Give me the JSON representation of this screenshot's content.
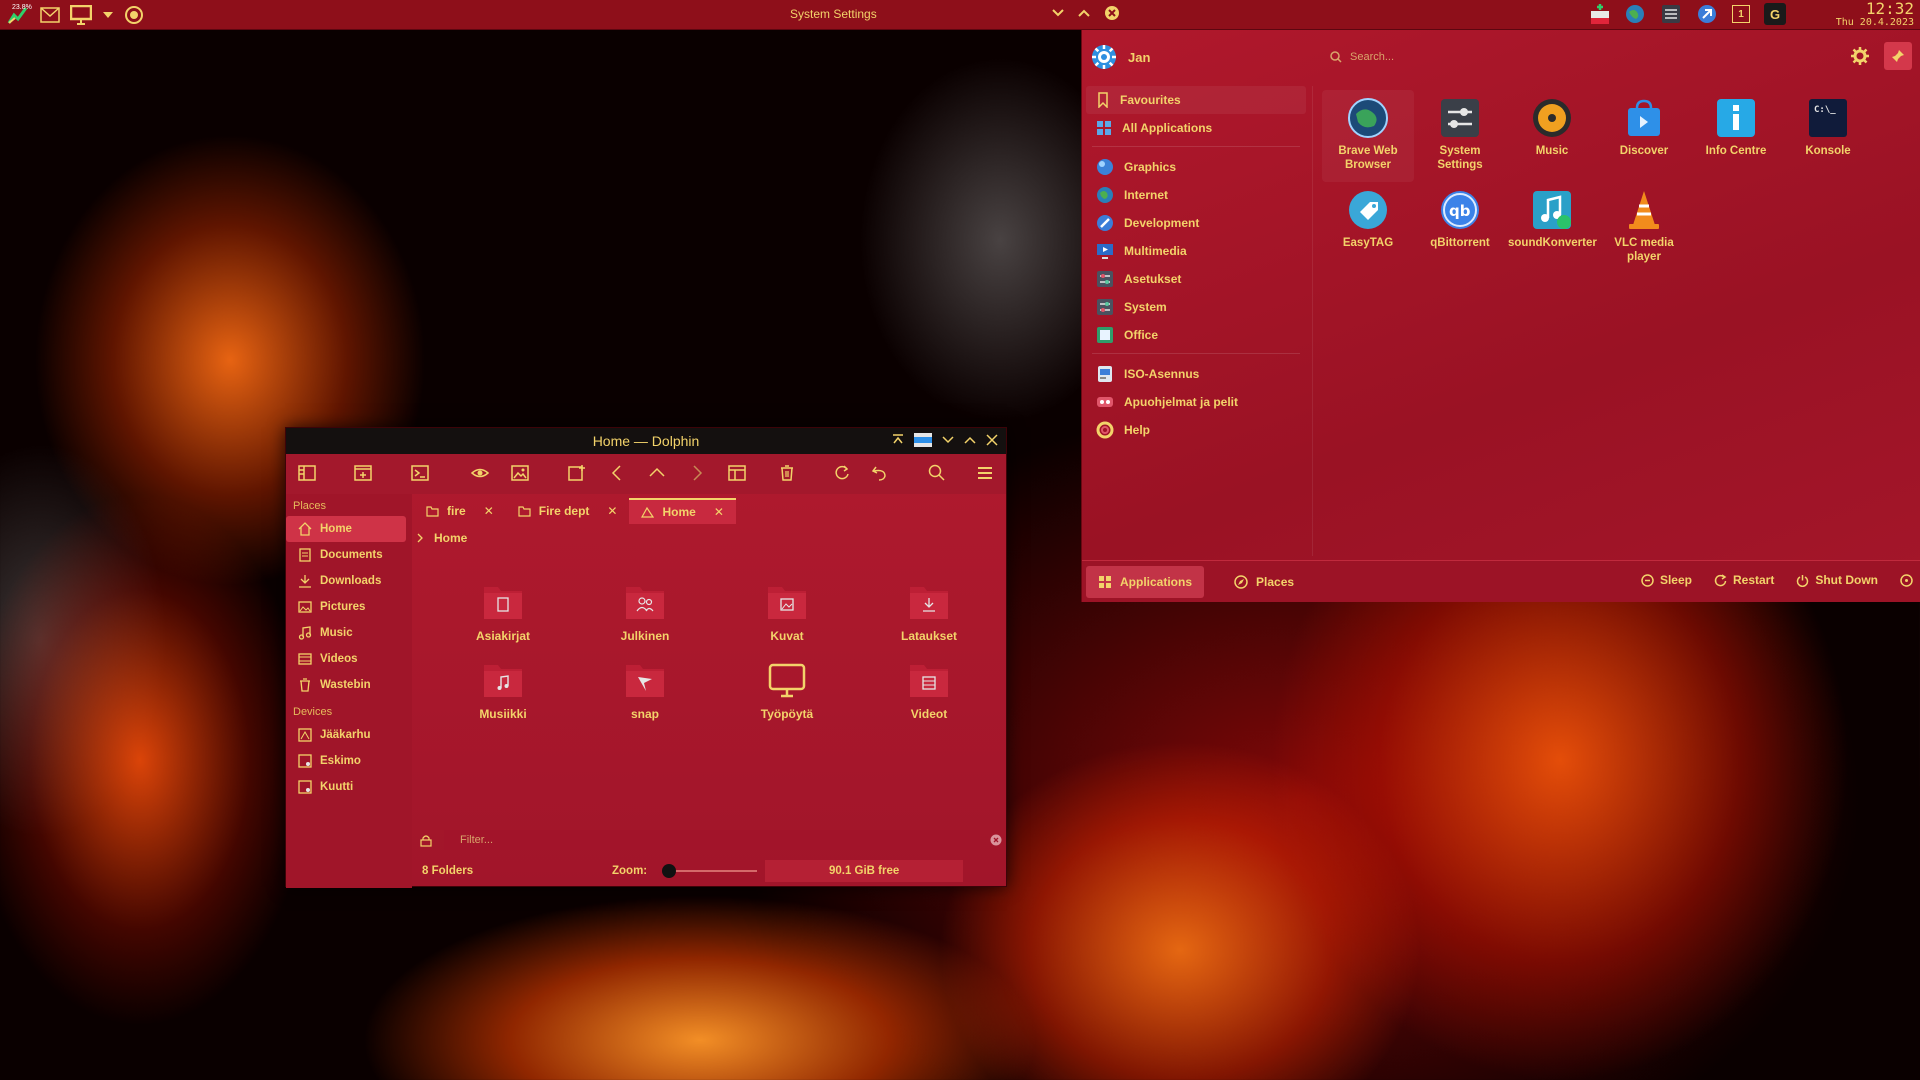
{
  "panel": {
    "cpu_label": "23.8%",
    "window_title": "System Settings",
    "clock_time": "12:32",
    "clock_date": "Thu 20.4.2023",
    "tray_workspace": "1",
    "tray_g": "G"
  },
  "launcher": {
    "user_name": "Jan",
    "search_placeholder": "Search...",
    "categories": [
      {
        "label": "Favourites",
        "icon": "bookmark-icon"
      },
      {
        "label": "All Applications",
        "icon": "grid-icon"
      },
      {
        "label": "Graphics",
        "icon": "graphics-icon"
      },
      {
        "label": "Internet",
        "icon": "globe-icon"
      },
      {
        "label": "Development",
        "icon": "development-icon"
      },
      {
        "label": "Multimedia",
        "icon": "multimedia-icon"
      },
      {
        "label": "Asetukset",
        "icon": "settings-icon"
      },
      {
        "label": "System",
        "icon": "system-icon"
      },
      {
        "label": "Office",
        "icon": "office-icon"
      },
      {
        "label": "ISO-Asennus",
        "icon": "iso-icon"
      },
      {
        "label": "Apuohjelmat ja pelit",
        "icon": "games-icon"
      },
      {
        "label": "Help",
        "icon": "help-icon"
      }
    ],
    "apps": [
      {
        "label": "Brave Web Browser",
        "icon": "brave-icon"
      },
      {
        "label": "System Settings",
        "icon": "system-settings-icon"
      },
      {
        "label": "Music",
        "icon": "music-icon"
      },
      {
        "label": "Discover",
        "icon": "discover-icon"
      },
      {
        "label": "Info Centre",
        "icon": "info-centre-icon"
      },
      {
        "label": "Konsole",
        "icon": "konsole-icon"
      },
      {
        "label": "EasyTAG",
        "icon": "easytag-icon"
      },
      {
        "label": "qBittorrent",
        "icon": "qbittorrent-icon"
      },
      {
        "label": "soundKonverter",
        "icon": "soundkonverter-icon"
      },
      {
        "label": "VLC media player",
        "icon": "vlc-icon"
      }
    ],
    "footer": {
      "applications": "Applications",
      "places": "Places",
      "sleep": "Sleep",
      "restart": "Restart",
      "shutdown": "Shut Down"
    },
    "konsole_prompt": "C:\\_"
  },
  "dolphin": {
    "title": "Home — Dolphin",
    "places_header": "Places",
    "places": [
      "Home",
      "Documents",
      "Downloads",
      "Pictures",
      "Music",
      "Videos",
      "Wastebin"
    ],
    "devices_header": "Devices",
    "devices": [
      "Jääkarhu",
      "Eskimo",
      "Kuutti"
    ],
    "tabs": [
      "fire",
      "Fire dept",
      "Home"
    ],
    "breadcrumb": "Home",
    "folders": [
      {
        "label": "Asiakirjat",
        "icon": "document-folder-icon"
      },
      {
        "label": "Julkinen",
        "icon": "public-folder-icon"
      },
      {
        "label": "Kuvat",
        "icon": "pictures-folder-icon"
      },
      {
        "label": "Lataukset",
        "icon": "downloads-folder-icon"
      },
      {
        "label": "Musiikki",
        "icon": "music-folder-icon"
      },
      {
        "label": "snap",
        "icon": "snap-folder-icon"
      },
      {
        "label": "Työpöytä",
        "icon": "desktop-icon"
      },
      {
        "label": "Videot",
        "icon": "videos-folder-icon"
      }
    ],
    "filter_placeholder": "Filter...",
    "status_folders": "8 Folders",
    "zoom_label": "Zoom:",
    "free_space": "90.1 GiB free",
    "zoom_level": 0
  },
  "colors": {
    "accent_text": "#f3d36a",
    "panel_bg": "#8e0f1a",
    "selection": "#cf3347"
  }
}
